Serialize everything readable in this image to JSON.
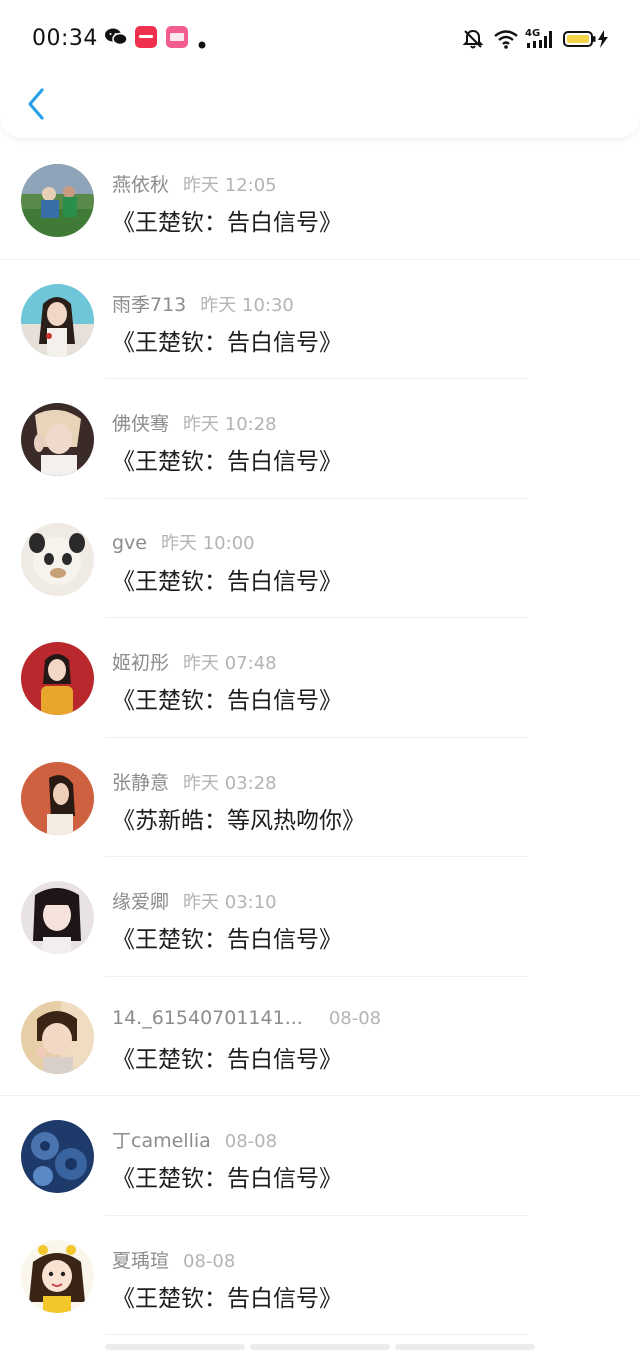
{
  "status_bar": {
    "time": "00:34",
    "notification_icons": [
      "wechat-icon",
      "xiaohongshu-icon",
      "app-icon",
      "dot-icon"
    ],
    "right_icons": [
      "bell-mute-icon",
      "wifi-icon",
      "4g-signal-icon",
      "battery-charging-icon"
    ],
    "network_label": "4G"
  },
  "header": {
    "back_icon": "chevron-left-icon",
    "accent_color": "#2aa0e6"
  },
  "messages": [
    {
      "name": "燕依秋",
      "time": "昨天 12:05",
      "text": "《王楚钦：告白信号》"
    },
    {
      "name": "雨季713",
      "time": "昨天 10:30",
      "text": "《王楚钦：告白信号》"
    },
    {
      "name": "佛侠骞",
      "time": "昨天 10:28",
      "text": "《王楚钦：告白信号》"
    },
    {
      "name": "gve",
      "time": "昨天 10:00",
      "text": "《王楚钦：告白信号》"
    },
    {
      "name": "姬初彤",
      "time": "昨天 07:48",
      "text": "《王楚钦：告白信号》"
    },
    {
      "name": "张静意",
      "time": "昨天 03:28",
      "text": "《苏新皓：等风热吻你》"
    },
    {
      "name": "缘爱卿",
      "time": "昨天 03:10",
      "text": "《王楚钦：告白信号》"
    },
    {
      "name": "14._61540701141...",
      "time": "08-08",
      "text": "《王楚钦：告白信号》"
    },
    {
      "name": "丁camellia",
      "time": "08-08",
      "text": "《王楚钦：告白信号》"
    },
    {
      "name": "夏瑀瑄",
      "time": "08-08",
      "text": "《王楚钦：告白信号》"
    }
  ]
}
